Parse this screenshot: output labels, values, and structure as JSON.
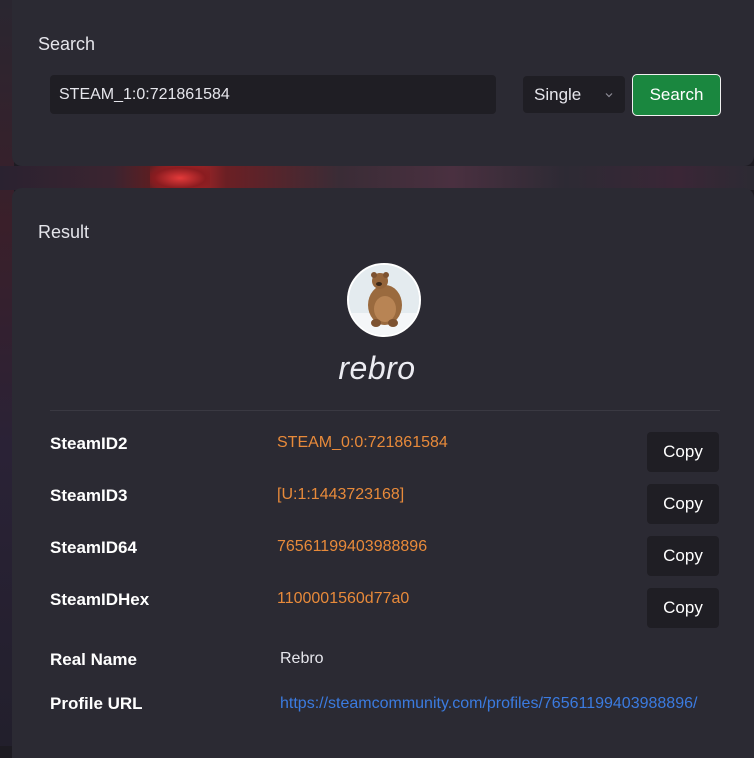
{
  "search": {
    "title": "Search",
    "input_value": "STEAM_1:0:721861584",
    "mode_selected": "Single",
    "button_label": "Search"
  },
  "result": {
    "title": "Result",
    "username": "rebro",
    "rows": [
      {
        "label": "SteamID2",
        "value": "STEAM_0:0:721861584",
        "copy": "Copy"
      },
      {
        "label": "SteamID3",
        "value": "[U:1:1443723168]",
        "copy": "Copy"
      },
      {
        "label": "SteamID64",
        "value": "76561199403988896",
        "copy": "Copy"
      },
      {
        "label": "SteamIDHex",
        "value": "1100001560d77a0",
        "copy": "Copy"
      }
    ],
    "real_name": {
      "label": "Real Name",
      "value": "Rebro"
    },
    "profile_url": {
      "label": "Profile URL",
      "value": "https://steamcommunity.com/profiles/76561199403988896/"
    }
  },
  "colors": {
    "accent_green": "#1a873f",
    "value_orange": "#e88a3a",
    "link_blue": "#3b7be0",
    "panel": "#2b2a33"
  }
}
